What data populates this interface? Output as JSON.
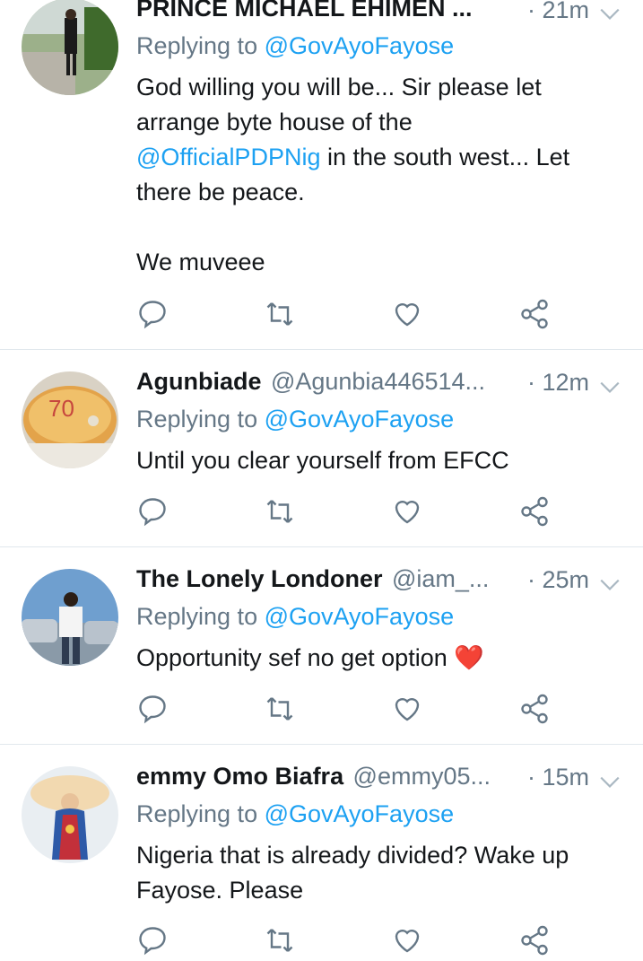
{
  "tweets": [
    {
      "name": "PRINCE MICHAEL EHIMEN ...",
      "handle": "",
      "time": "· 21m",
      "replying_prefix": "Replying to ",
      "replying_handle": "@GovAyoFayose",
      "body_line1": "God willing you will be... Sir please let",
      "body_line2": "arrange byte house of the",
      "body_mention": "@OfficialPDPNig",
      "body_line3_rest": " in the south west... Let",
      "body_line4": "there be peace.",
      "body_line5": "We muveee"
    },
    {
      "name": "Agunbiade",
      "handle": "@Agunbia446514...",
      "time": "· 12m",
      "replying_prefix": "Replying to ",
      "replying_handle": "@GovAyoFayose",
      "body_line1": "Until you clear yourself from EFCC"
    },
    {
      "name": "The Lonely Londoner",
      "handle": "@iam_...",
      "time": "· 25m",
      "replying_prefix": "Replying to ",
      "replying_handle": "@GovAyoFayose",
      "body_line1": "Opportunity sef no get option",
      "emoji": "❤️"
    },
    {
      "name": "emmy Omo Biafra",
      "handle": "@emmy05...",
      "time": "· 15m",
      "replying_prefix": "Replying to ",
      "replying_handle": "@GovAyoFayose",
      "body_line1": "Nigeria that is already divided? Wake up",
      "body_line2": "Fayose. Please"
    }
  ],
  "colors": {
    "link": "#1da1f2",
    "secondary_text": "#657786",
    "primary_text": "#14171a",
    "divider": "#e1e8ed",
    "icon": "#657786"
  },
  "icons": [
    "reply-icon",
    "retweet-icon",
    "like-icon",
    "share-icon",
    "chevron-down-icon"
  ]
}
